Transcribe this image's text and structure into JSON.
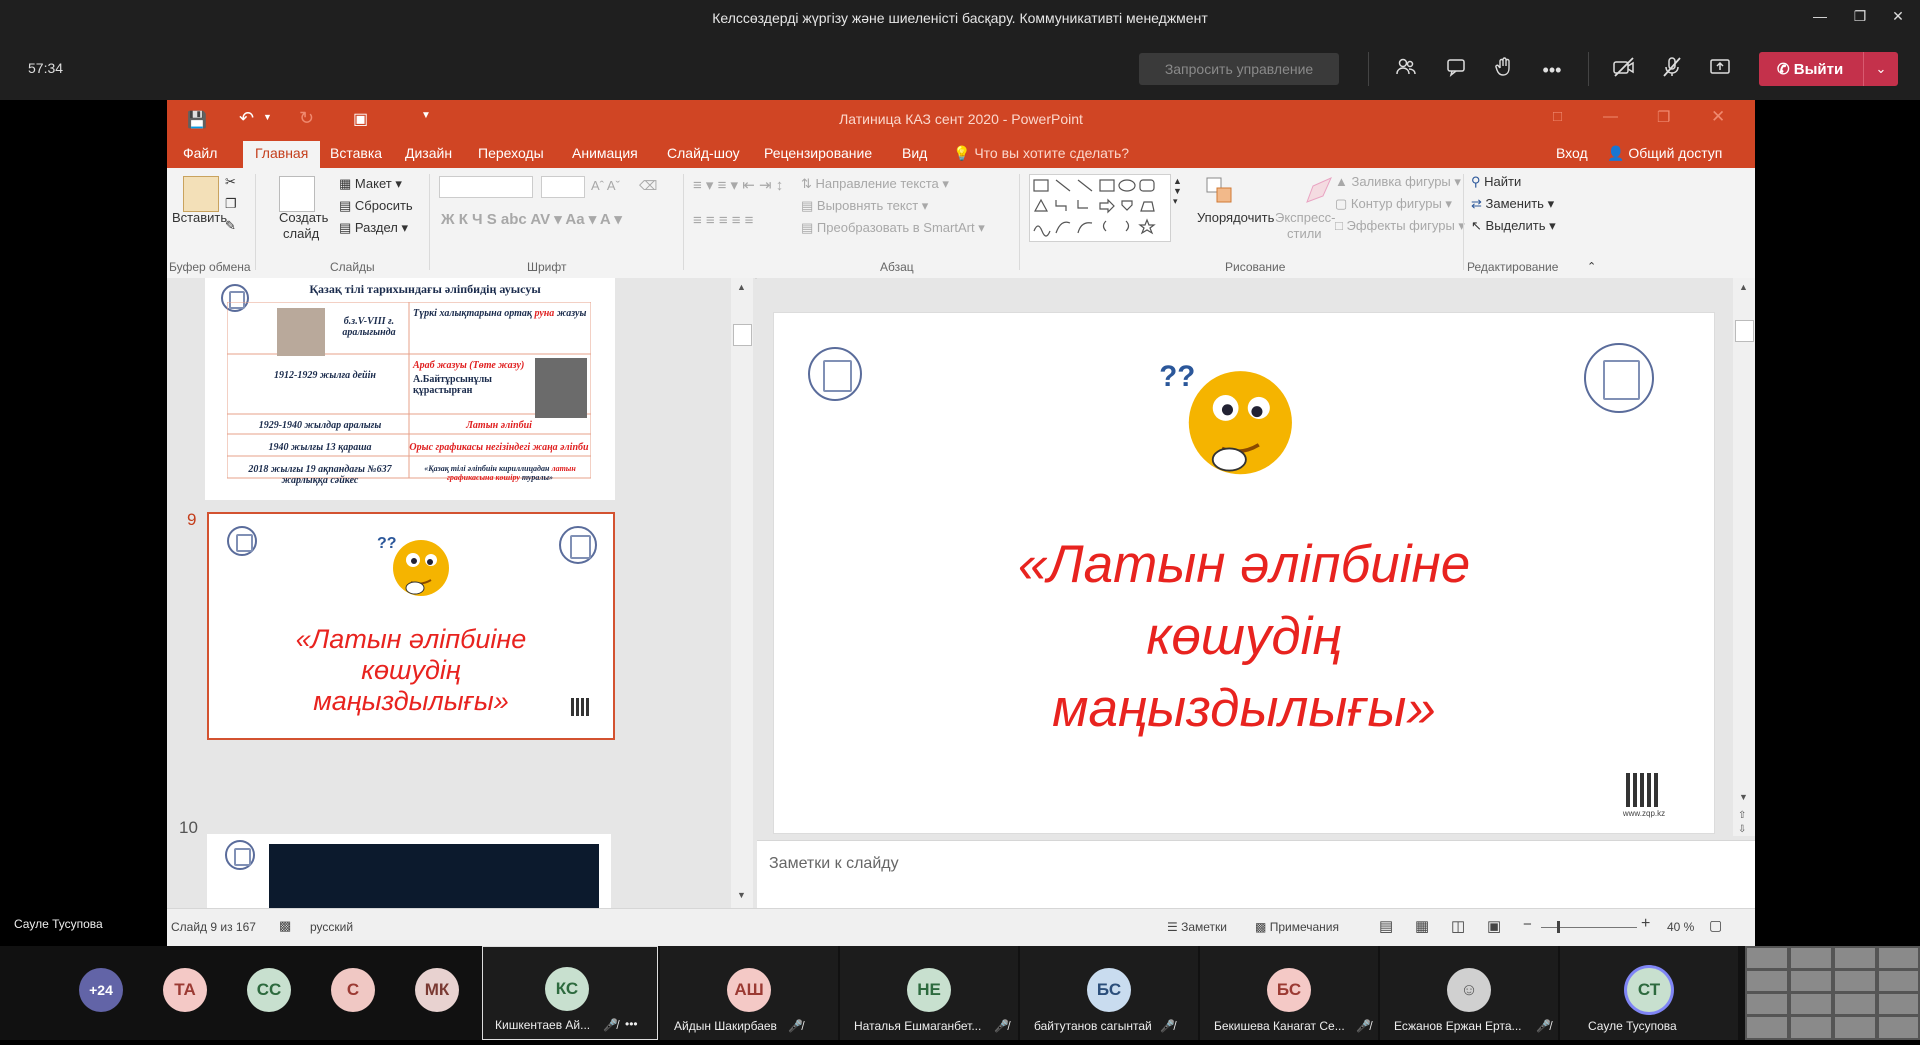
{
  "teams": {
    "window_title": "Келссөздерді жүргізу және шиеленісті басқару. Коммуникативті менеджмент",
    "timer": "57:34",
    "request_control": "Запросить управление",
    "leave": "Выйти",
    "presenter": "Сауле Тусупова"
  },
  "ppt": {
    "title": "Латиница  КАЗ сент 2020 - PowerPoint",
    "tabs": [
      "Файл",
      "Главная",
      "Вставка",
      "Дизайн",
      "Переходы",
      "Анимация",
      "Слайд-шоу",
      "Рецензирование",
      "Вид"
    ],
    "tell_me": "Что вы хотите сделать?",
    "signin": "Вход",
    "share": "Общий доступ",
    "ribbon": {
      "paste": "Вставить",
      "clipboard_group": "Буфер обмена",
      "new_slide": "Создать",
      "new_slide2": "слайд",
      "layout": "Макет",
      "reset": "Сбросить",
      "section": "Раздел",
      "slides_group": "Слайды",
      "font_group": "Шрифт",
      "text_direction": "Направление текста",
      "align_text": "Выровнять текст",
      "smartart": "Преобразовать в SmartArt",
      "paragraph_group": "Абзац",
      "arrange": "Упорядочить",
      "quick_styles": "Экспресс-",
      "quick_styles2": "стили",
      "shape_fill": "Заливка фигуры",
      "shape_outline": "Контур фигуры",
      "shape_effects": "Эффекты фигуры",
      "drawing_group": "Рисование",
      "find": "Найти",
      "replace": "Заменить",
      "select": "Выделить",
      "editing_group": "Редактирование"
    },
    "thumb8": {
      "heading": "Қазақ тілі тарихындағы әліпбидің ауысуы",
      "r1c1": "б.з.V-VIII ғ. аралығында",
      "r1c2a": "Түркі халықтарына ортақ ",
      "r1c2b": "руна",
      "r1c2c": " жазуы",
      "r2c1": "1912-1929 жылға дейін",
      "r2c2a": "Араб жазуы (Төте жазу)",
      "r2c2b": "А.Байтұрсынұлы құрастырған",
      "r3c1": "1929-1940 жылдар аралығы",
      "r3c2": "Латын әліпбиі",
      "r4c1": "1940 жылғы 13 қараша",
      "r4c2": "Орыс графикасы негізіндегі жаңа әліпби",
      "r5c1": "2018 жылғы 19 ақпандағы №637 жарлыққа сәйкес",
      "r5c2a": "«Қазақ тілі әліпбиін кириллицадан ",
      "r5c2b": "латын графикасына көшіру",
      "r5c2c": " туралы»"
    },
    "slide_num_9": "9",
    "slide_num_10": "10",
    "slide_title_l1": "«Латын әліпбиіне",
    "slide_title_l2": "көшудің",
    "slide_title_l3": "маңыздылығы»",
    "qr_caption": "www.zqp.kz",
    "notes_placeholder": "Заметки к слайду",
    "status": {
      "slide_of": "Слайд 9 из 167",
      "language": "русский",
      "notes": "Заметки",
      "comments": "Примечания",
      "zoom": "40 %"
    }
  },
  "participants": [
    {
      "initials": "+24",
      "color": "#6264a7"
    },
    {
      "initials": "ТА",
      "color": "#f4c9c6"
    },
    {
      "initials": "СС",
      "color": "#c8e0cf"
    },
    {
      "initials": "С",
      "color": "#f0c8c4"
    },
    {
      "initials": "МК",
      "color": "#e8d2d0"
    },
    {
      "initials": "КС",
      "name": "Кишкентаев Ай...",
      "color": "#c8e0cf"
    },
    {
      "initials": "АШ",
      "name": "Айдын Шакирбаев",
      "color": "#f4c9c6"
    },
    {
      "initials": "НЕ",
      "name": "Наталья Ешмаганбет...",
      "color": "#c8e0cf"
    },
    {
      "initials": "БС",
      "name": "байтутанов сагынтай",
      "color": "#c9dcef"
    },
    {
      "initials": "БС",
      "name": "Бекишева Канагат Се...",
      "color": "#f4c9c6"
    },
    {
      "initials": "",
      "name": "Есжанов Ержан Ерта...",
      "color": "#d0d0d0"
    },
    {
      "initials": "СТ",
      "name": "Сауле Тусупова",
      "color": "#c8e0cf"
    }
  ],
  "colors": {
    "ppt_accent": "#d04524",
    "leave": "#c4314b",
    "slide_red": "#e8231f"
  }
}
